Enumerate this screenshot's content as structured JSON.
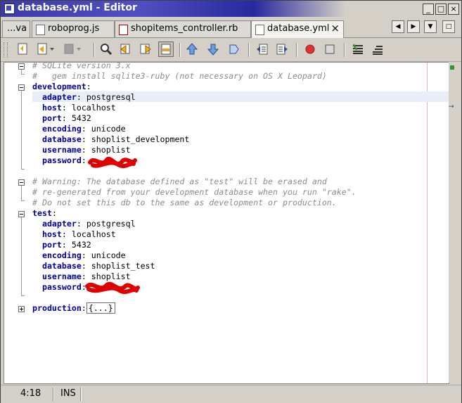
{
  "window": {
    "title": "database.yml - Editor"
  },
  "tabs": [
    {
      "label": "...va"
    },
    {
      "label": "roboprog.js"
    },
    {
      "label": "shopitems_controller.rb"
    },
    {
      "label": "database.yml"
    }
  ],
  "toolbar_icons": [
    "last-edit-icon",
    "back-icon",
    "forward-icon",
    "find-icon",
    "find-previous-icon",
    "find-next-icon",
    "toggle-highlight-icon",
    "previous-bookmark-icon",
    "next-bookmark-icon",
    "toggle-bookmark-icon",
    "shift-left-icon",
    "shift-right-icon",
    "record-macro-icon",
    "stop-macro-icon",
    "comment-icon",
    "uncomment-icon"
  ],
  "code": {
    "comment1": "# SQLite version 3.x",
    "comment2": "#   gem install sqlite3-ruby (not necessary on OS X Leopard)",
    "development": {
      "key": "development",
      "adapter": {
        "key": "adapter",
        "value": "postgresql"
      },
      "host": {
        "key": "host",
        "value": "localhost"
      },
      "port": {
        "key": "port",
        "value": "5432"
      },
      "encoding": {
        "key": "encoding",
        "value": "unicode"
      },
      "database": {
        "key": "database",
        "value": "shoplist_development"
      },
      "username": {
        "key": "username",
        "value": "shoplist"
      },
      "password": {
        "key": "password"
      }
    },
    "warning1": "# Warning: The database defined as \"test\" will be erased and",
    "warning2": "# re-generated from your development database when you run \"rake\".",
    "warning3": "# Do not set this db to the same as development or production.",
    "test": {
      "key": "test",
      "adapter": {
        "key": "adapter",
        "value": "postgresql"
      },
      "host": {
        "key": "host",
        "value": "localhost"
      },
      "port": {
        "key": "port",
        "value": "5432"
      },
      "encoding": {
        "key": "encoding",
        "value": "unicode"
      },
      "database": {
        "key": "database",
        "value": "shoplist_test"
      },
      "username": {
        "key": "username",
        "value": "shoplist"
      },
      "password": {
        "key": "password"
      }
    },
    "production": {
      "key": "production",
      "collapsed": "{...}"
    }
  },
  "status": {
    "position": "4:18",
    "mode": "INS"
  },
  "colors": {
    "keyword": "#00009c",
    "comment": "#8c8c8c",
    "redaction": "#e00000"
  }
}
